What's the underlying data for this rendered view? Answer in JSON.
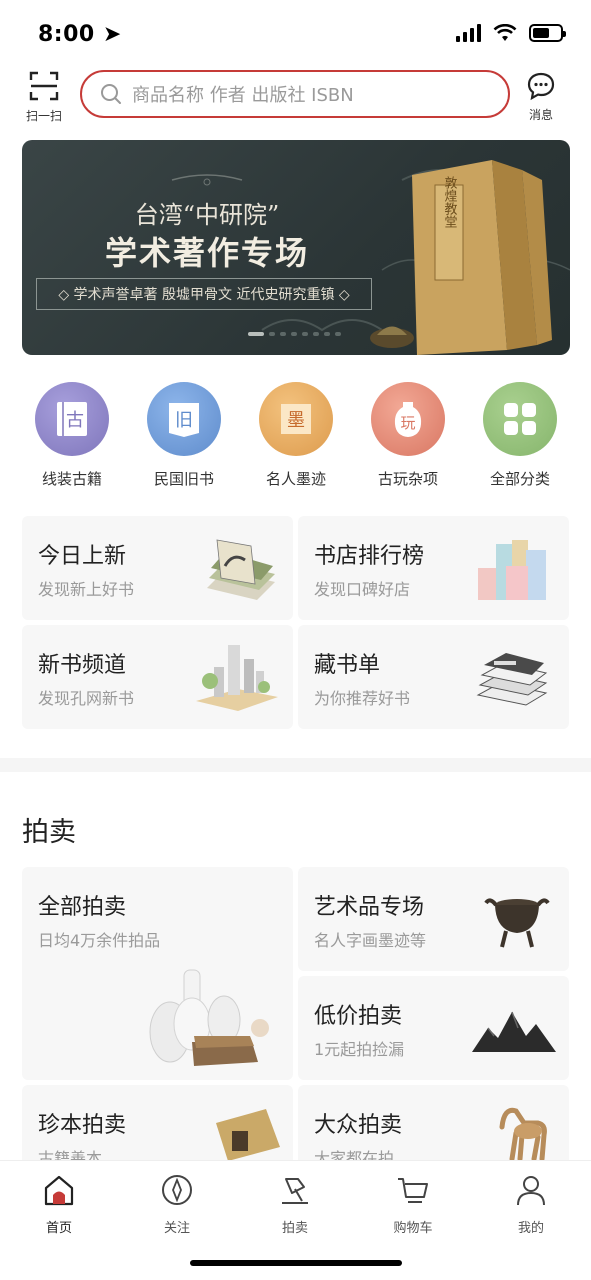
{
  "status_bar": {
    "time": "8:00"
  },
  "header": {
    "scan_label": "扫一扫",
    "search_placeholder": "商品名称 作者 出版社 ISBN",
    "message_label": "消息"
  },
  "banner": {
    "subtitle": "台湾“中研院”",
    "title": "学术著作专场",
    "tagline": "◇ 学术声誉卓著  殷墟甲骨文 近代史研究重镇 ◇",
    "book_title": "敦煌教堂"
  },
  "categories": [
    {
      "label": "线装古籍",
      "glyph": "古",
      "icon": "thread-bound-book-icon",
      "color": "#8f86c7"
    },
    {
      "label": "民国旧书",
      "glyph": "旧",
      "icon": "old-book-icon",
      "color": "#6f99d6"
    },
    {
      "label": "名人墨迹",
      "glyph": "墨",
      "icon": "calligraphy-icon",
      "color": "#e7a95b"
    },
    {
      "label": "古玩杂项",
      "glyph": "玩",
      "icon": "antique-vase-icon",
      "color": "#e58872"
    },
    {
      "label": "全部分类",
      "glyph": "",
      "icon": "all-categories-icon",
      "color": "#93c07a"
    }
  ],
  "discover": [
    {
      "title": "今日上新",
      "subtitle": "发现新上好书"
    },
    {
      "title": "书店排行榜",
      "subtitle": "发现口碑好店"
    },
    {
      "title": "新书频道",
      "subtitle": "发现孔网新书"
    },
    {
      "title": "藏书单",
      "subtitle": "为你推荐好书"
    }
  ],
  "auction": {
    "section_title": "拍卖",
    "cards": [
      {
        "title": "全部拍卖",
        "subtitle": "日均4万余件拍品"
      },
      {
        "title": "艺术品专场",
        "subtitle": "名人字画墨迹等"
      },
      {
        "title": "低价拍卖",
        "subtitle": "1元起拍捡漏"
      },
      {
        "title": "珍本拍卖",
        "subtitle": "古籍善本"
      },
      {
        "title": "大众拍卖",
        "subtitle": "大家都在拍"
      }
    ]
  },
  "tabbar": [
    {
      "label": "首页",
      "icon": "home-icon",
      "active": true
    },
    {
      "label": "关注",
      "icon": "compass-icon",
      "active": false
    },
    {
      "label": "拍卖",
      "icon": "gavel-icon",
      "active": false
    },
    {
      "label": "购物车",
      "icon": "cart-icon",
      "active": false
    },
    {
      "label": "我的",
      "icon": "user-icon",
      "active": false
    }
  ],
  "colors": {
    "accent": "#c63b38",
    "banner_bg": "#2f3a3b",
    "card_bg": "#f7f7f7"
  }
}
